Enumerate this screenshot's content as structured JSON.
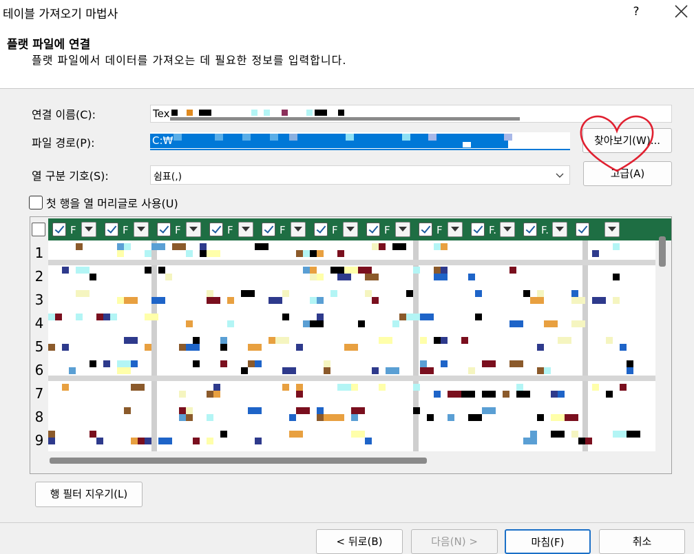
{
  "window": {
    "title": "테이블 가져오기 마법사",
    "help": "?"
  },
  "header": {
    "title": "플랫 파일에 연결",
    "description": "플랫 파일에서 데이터를 가져오는 데 필요한 정보를 입력합니다."
  },
  "form": {
    "connection_name_label": "연결 이름(C):",
    "connection_name_value": "Tex",
    "file_path_label": "파일 경로(P):",
    "file_path_value": "C:₩",
    "browse_label": "찾아보기(W)...",
    "delimiter_label": "열 구분 기호(S):",
    "delimiter_value": "쉼표(,)",
    "advanced_label": "고급(A)",
    "first_row_header_label": "첫 행을 열 머리글로 사용(U)"
  },
  "grid": {
    "columns": [
      "F",
      "F",
      "F",
      "F",
      "F",
      "F",
      "F",
      "F",
      "F.",
      "F.",
      ""
    ],
    "row_numbers": [
      "1",
      "2",
      "3",
      "4",
      "5",
      "6",
      "7",
      "8",
      "9"
    ]
  },
  "clear_filter_label": "행 필터 지우기(L)",
  "footer": {
    "back_label": "< 뒤로(B)",
    "next_label": "다음(N) >",
    "finish_label": "마침(F)",
    "cancel_label": "취소"
  },
  "annotation": {
    "shape": "heart",
    "color": "#e02030"
  },
  "colors": {
    "header_green": "#1e6e43",
    "selection_blue": "#0078d7",
    "pixel_palette": [
      "#000000",
      "#7a0f1e",
      "#1e64c8",
      "#f5f5c0",
      "#b3f5f5",
      "#e8a040",
      "#8b5a2b",
      "#2e3a8c",
      "#ffffaa",
      "#5a9fd4"
    ]
  }
}
